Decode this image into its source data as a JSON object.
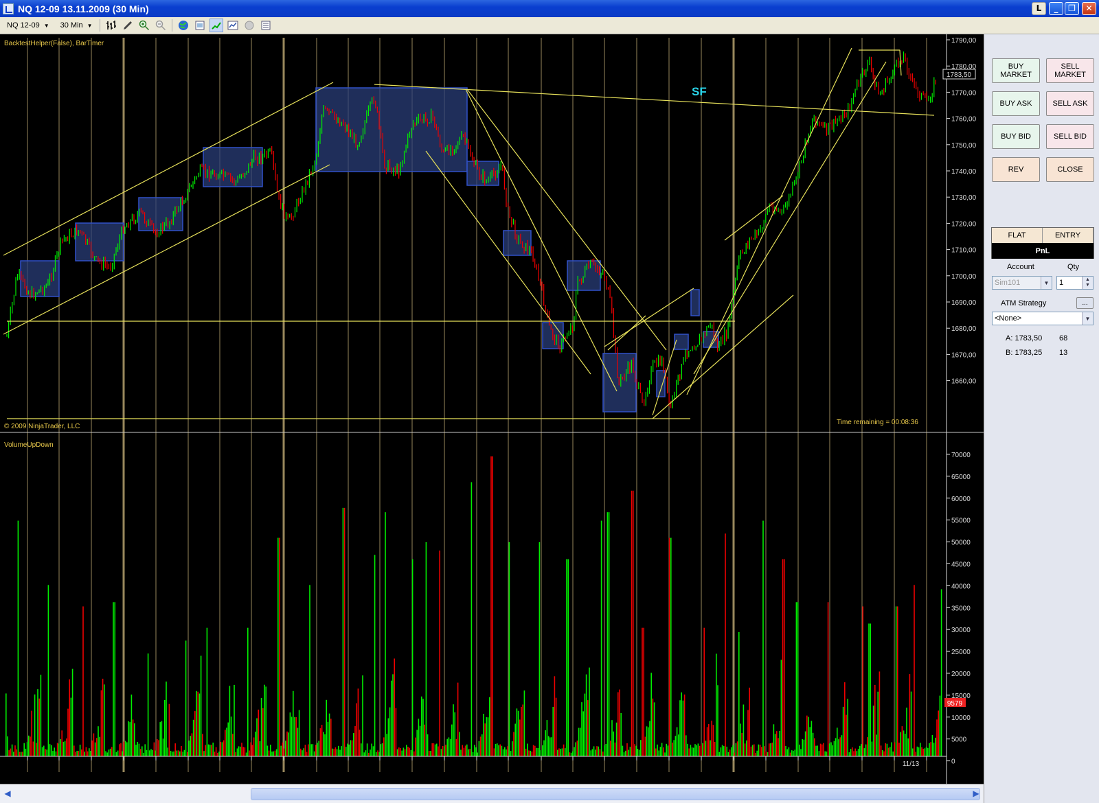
{
  "window": {
    "title": "NQ 12-09  13.11.2009 (30 Min)",
    "btn_l": "L",
    "btn_min": "_",
    "btn_restore": "❐",
    "btn_close": "✕"
  },
  "toolbar": {
    "instrument": "NQ 12-09",
    "period": "30 Min"
  },
  "chart": {
    "indicator_label": "BacktestHelper(False), BarTimer",
    "copyright": "© 2009 NinjaTrader, LLC",
    "time_remaining": "Time remaining = 00:08:36",
    "annotation": "SF",
    "volume_label": "VolumeUpDown",
    "price_ticks": [
      "1790,00",
      "1780,00",
      "1770,00",
      "1760,00",
      "1750,00",
      "1740,00",
      "1730,00",
      "1720,00",
      "1710,00",
      "1700,00",
      "1690,00",
      "1680,00",
      "1670,00",
      "1660,00"
    ],
    "volume_ticks": [
      "70000",
      "65000",
      "60000",
      "55000",
      "50000",
      "45000",
      "40000",
      "35000",
      "30000",
      "25000",
      "20000",
      "15000",
      "10000",
      "5000",
      "0"
    ],
    "current_price": "1783,50",
    "current_volume": "9579",
    "date_label": "11/13",
    "colors": {
      "up": "#00ee00",
      "down": "#ee0000",
      "line": "#e6e05a",
      "grid": "#b4a06e",
      "box": "#2a3d78",
      "box_border": "#3050c8"
    }
  },
  "panel": {
    "buy_market": "BUY MARKET",
    "sell_market": "SELL MARKET",
    "buy_ask": "BUY ASK",
    "sell_ask": "SELL ASK",
    "buy_bid": "BUY BID",
    "sell_bid": "SELL BID",
    "rev": "REV",
    "close": "CLOSE",
    "flat": "FLAT",
    "entry": "ENTRY",
    "pnl": "PnL",
    "account_label": "Account",
    "qty_label": "Qty",
    "account_value": "Sim101",
    "qty_value": "1",
    "atm_label": "ATM Strategy",
    "atm_button": "...",
    "atm_value": "<None>",
    "ask_label": "A: 1783,50",
    "ask_size": "68",
    "bid_label": "B: 1783,25",
    "bid_size": "13"
  }
}
